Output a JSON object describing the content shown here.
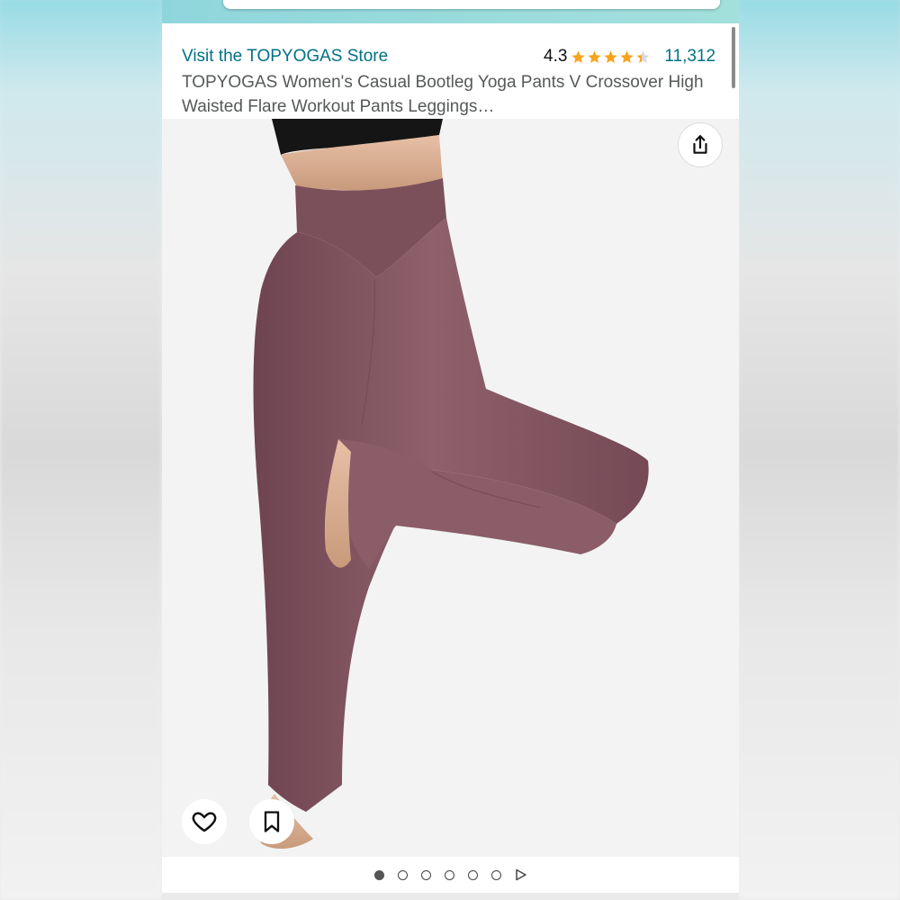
{
  "store_link": "Visit the TOPYOGAS Store",
  "rating": {
    "value": "4.3",
    "stars": 4.3,
    "review_count": "11,312",
    "star_color": "#f7a31c"
  },
  "product_title": "TOPYOGAS Women's Casual Bootleg Yoga Pants V Crossover High Waisted Flare Workout Pants Leggings…",
  "image_gallery": {
    "current_index": 1,
    "total": 7,
    "product_color": "#875a65"
  },
  "icons": {
    "share": "share-icon",
    "favorite": "heart-icon",
    "save": "bookmark-icon",
    "next": "play-icon"
  },
  "colors": {
    "link": "#007185",
    "title_text": "#565959",
    "accent_teal": "#8fd6dc"
  }
}
